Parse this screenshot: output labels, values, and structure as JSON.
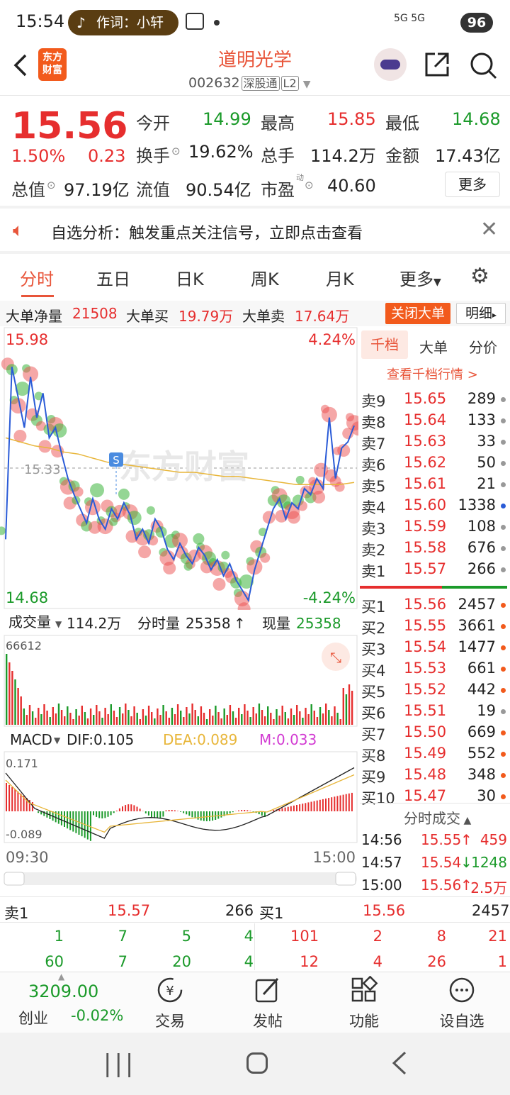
{
  "status": {
    "time": "15:54",
    "pill_text": "作词：小轩",
    "network": "5G  5G",
    "battery": "96"
  },
  "header": {
    "name": "道明光学",
    "code": "002632",
    "exchange_tag": "深股通",
    "level_tag": "L2",
    "logo": "东方\n财富"
  },
  "quote": {
    "price": "15.56",
    "change_pct": "1.50%",
    "change": "0.23",
    "open_label": "今开",
    "open": "14.99",
    "high_label": "最高",
    "high": "15.85",
    "low_label": "最低",
    "low": "14.68",
    "turnover_label": "换手",
    "turnover": "19.62%",
    "volume_label": "总手",
    "volume": "114.2万",
    "amount_label": "金额",
    "amount": "17.43亿",
    "mktcap_label": "总值",
    "mktcap": "97.19亿",
    "float_label": "流值",
    "float": "90.54亿",
    "pe_label": "市盈",
    "pe_sup": "动",
    "pe": "40.60",
    "more": "更多"
  },
  "notice": {
    "text": "自选分析：触发重点关注信号，立即点击查看"
  },
  "tabs": [
    "分时",
    "五日",
    "日K",
    "周K",
    "月K",
    "更多"
  ],
  "large_orders": {
    "net_label": "大单净量",
    "net": "21508",
    "buy_label": "大单买",
    "buy": "19.79万",
    "sell_label": "大单卖",
    "sell": "17.64万",
    "close_btn": "关闭大单",
    "detail_btn": "明细"
  },
  "chart_data": {
    "type": "line",
    "title": "",
    "y_max_label": "15.98",
    "y_min_label": "14.68",
    "y_mid_label": "15.33",
    "pct_max_label": "4.24%",
    "pct_min_label": "-4.24%",
    "x_start": "09:30",
    "x_end": "15:00",
    "ylim": [
      14.68,
      15.98
    ],
    "price_series": [
      15.0,
      15.85,
      15.7,
      15.55,
      15.8,
      15.6,
      15.72,
      15.5,
      15.55,
      15.42,
      15.3,
      15.22,
      15.15,
      15.08,
      15.2,
      15.1,
      15.05,
      15.15,
      15.1,
      15.18,
      15.12,
      15.0,
      15.05,
      14.98,
      15.1,
      15.05,
      14.95,
      14.9,
      14.98,
      14.92,
      14.88,
      14.96,
      14.92,
      14.85,
      14.9,
      14.82,
      14.88,
      14.8,
      14.75,
      14.7,
      14.85,
      14.95,
      15.05,
      15.15,
      15.2,
      15.1,
      15.18,
      15.15,
      15.25,
      15.22,
      15.3,
      15.25,
      15.6,
      15.3,
      15.45,
      15.48,
      15.56
    ],
    "avg_series": [
      15.5,
      15.48,
      15.46,
      15.45,
      15.43,
      15.42,
      15.4,
      15.38,
      15.37,
      15.36,
      15.35,
      15.34,
      15.33,
      15.33,
      15.32,
      15.31,
      15.31,
      15.3,
      15.29,
      15.28,
      15.27,
      15.27,
      15.27,
      15.27,
      15.28
    ],
    "volume_label": "成交量",
    "volume_total": "114.2万",
    "tick_vol_label": "分时量",
    "tick_vol": "25358",
    "now_vol_label": "现量",
    "now_vol": "25358",
    "vol_max_label": "66612",
    "macd_label": "MACD",
    "dif_label": "DIF:0.105",
    "dea_label": "DEA:0.089",
    "m_label": "M:0.033",
    "macd_max_label": "0.171",
    "macd_min_label": "-0.089"
  },
  "orderbook": {
    "tabs": [
      "千档",
      "大单",
      "分价"
    ],
    "link": "查看千档行情 >",
    "asks": [
      {
        "label": "卖9",
        "price": "15.65",
        "vol": "289"
      },
      {
        "label": "卖8",
        "price": "15.64",
        "vol": "133"
      },
      {
        "label": "卖7",
        "price": "15.63",
        "vol": "33"
      },
      {
        "label": "卖6",
        "price": "15.62",
        "vol": "50"
      },
      {
        "label": "卖5",
        "price": "15.61",
        "vol": "21"
      },
      {
        "label": "卖4",
        "price": "15.60",
        "vol": "1338"
      },
      {
        "label": "卖3",
        "price": "15.59",
        "vol": "108"
      },
      {
        "label": "卖2",
        "price": "15.58",
        "vol": "676"
      },
      {
        "label": "卖1",
        "price": "15.57",
        "vol": "266"
      }
    ],
    "bids": [
      {
        "label": "买1",
        "price": "15.56",
        "vol": "2457"
      },
      {
        "label": "买2",
        "price": "15.55",
        "vol": "3661"
      },
      {
        "label": "买3",
        "price": "15.54",
        "vol": "1477"
      },
      {
        "label": "买4",
        "price": "15.53",
        "vol": "661"
      },
      {
        "label": "买5",
        "price": "15.52",
        "vol": "442"
      },
      {
        "label": "买6",
        "price": "15.51",
        "vol": "19"
      },
      {
        "label": "买7",
        "price": "15.50",
        "vol": "669"
      },
      {
        "label": "买8",
        "price": "15.49",
        "vol": "552"
      },
      {
        "label": "买9",
        "price": "15.48",
        "vol": "348"
      },
      {
        "label": "买10",
        "price": "15.47",
        "vol": "30"
      }
    ],
    "trades_head": "分时成交",
    "trades": [
      {
        "time": "14:56",
        "price": "15.55",
        "vol": "459",
        "dir": "↑"
      },
      {
        "time": "14:57",
        "price": "15.54",
        "vol": "1248",
        "dir": "↓"
      },
      {
        "time": "15:00",
        "price": "15.56",
        "vol": "2.5万",
        "dir": "↑"
      }
    ]
  },
  "quote_strip": {
    "sell_label": "卖1",
    "sell_price": "15.57",
    "sell_vol": "266",
    "buy_label": "买1",
    "buy_price": "15.56",
    "buy_vol": "2457",
    "sell_queue_1": [
      "1",
      "7",
      "5",
      "4"
    ],
    "buy_queue_1": [
      "101",
      "2",
      "8",
      "21"
    ],
    "sell_queue_2": [
      "60",
      "7",
      "20",
      "4"
    ],
    "buy_queue_2": [
      "12",
      "4",
      "26",
      "1"
    ]
  },
  "bottom_nav": {
    "index_value": "3209.00",
    "index_name": "创业",
    "index_change": "-0.02%",
    "items": [
      "交易",
      "发帖",
      "功能",
      "设自选"
    ]
  },
  "colors": {
    "up": "#e62e2e",
    "down": "#1b9a2a",
    "accent": "#e8553a"
  }
}
